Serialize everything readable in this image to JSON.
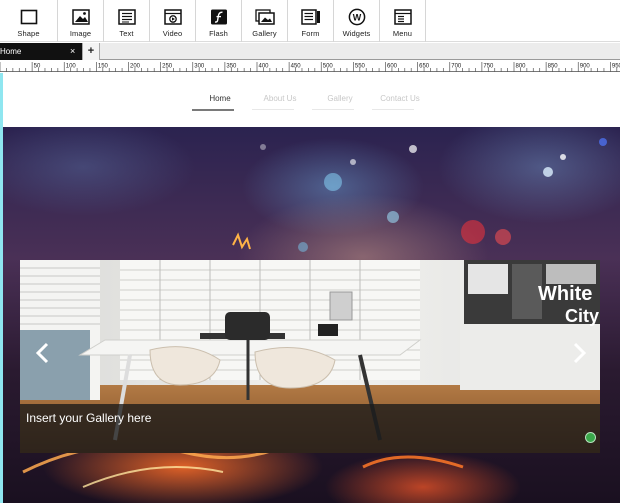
{
  "toolbar": {
    "items": [
      {
        "label": "Shape",
        "icon": "shape-icon"
      },
      {
        "label": "Image",
        "icon": "image-icon"
      },
      {
        "label": "Text",
        "icon": "text-icon"
      },
      {
        "label": "Video",
        "icon": "video-icon"
      },
      {
        "label": "Flash",
        "icon": "flash-icon"
      },
      {
        "label": "Gallery",
        "icon": "gallery-icon"
      },
      {
        "label": "Form",
        "icon": "form-icon"
      },
      {
        "label": "Widgets",
        "icon": "widgets-icon"
      },
      {
        "label": "Menu",
        "icon": "menu-icon"
      }
    ]
  },
  "tabs": {
    "active": "Home",
    "close": "×",
    "add": "+"
  },
  "ruler": {
    "labels": [
      "50",
      "100",
      "150",
      "200",
      "250",
      "300",
      "350",
      "400",
      "450",
      "500",
      "550",
      "600",
      "650",
      "700",
      "750",
      "800",
      "850",
      "900",
      "950"
    ]
  },
  "page_nav": {
    "items": [
      {
        "label": "Home",
        "active": true
      },
      {
        "label": "About Us",
        "active": false
      },
      {
        "label": "Gallery",
        "active": false
      },
      {
        "label": "Contact Us",
        "active": false
      }
    ]
  },
  "gallery": {
    "caption": "Insert your Gallery here",
    "artwork_text": [
      "White",
      "City"
    ],
    "prev_icon": "chevron-left-icon",
    "next_icon": "chevron-right-icon"
  },
  "colors": {
    "canvas_edge": "#8fe6f0",
    "tab_active_bg": "#111111",
    "caption_bg": "#191919",
    "status_dot": "#3aa84a"
  }
}
